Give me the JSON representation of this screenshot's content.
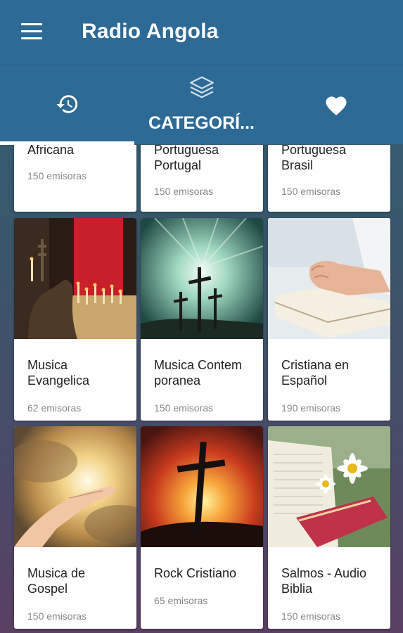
{
  "app": {
    "title": "Radio Angola"
  },
  "tabs": [
    {
      "name": "history",
      "label": ""
    },
    {
      "name": "categories",
      "label": "CATEGORÍ..."
    },
    {
      "name": "favorites",
      "label": ""
    }
  ],
  "categories": [
    {
      "name": "Africana",
      "count": "150 emisoras"
    },
    {
      "name": "Portuguesa\nPortugal",
      "count": "150 emisoras"
    },
    {
      "name": "Portuguesa\nBrasil",
      "count": "150 emisoras"
    },
    {
      "name": "Musica\nEvangelica",
      "count": "62 emisoras"
    },
    {
      "name": "Musica Contem\nporanea",
      "count": "150 emisoras"
    },
    {
      "name": "Cristiana en\nEspañol",
      "count": "190 emisoras"
    },
    {
      "name": "Musica de\nGospel",
      "count": "150 emisoras"
    },
    {
      "name": "Rock Cristiano",
      "count": "65 emisoras"
    },
    {
      "name": "Salmos - Audio\nBiblia",
      "count": "150 emisoras"
    }
  ],
  "colors": {
    "appbar": "#2d6a95",
    "indicator": "#ffffff",
    "card": "#ffffff"
  }
}
